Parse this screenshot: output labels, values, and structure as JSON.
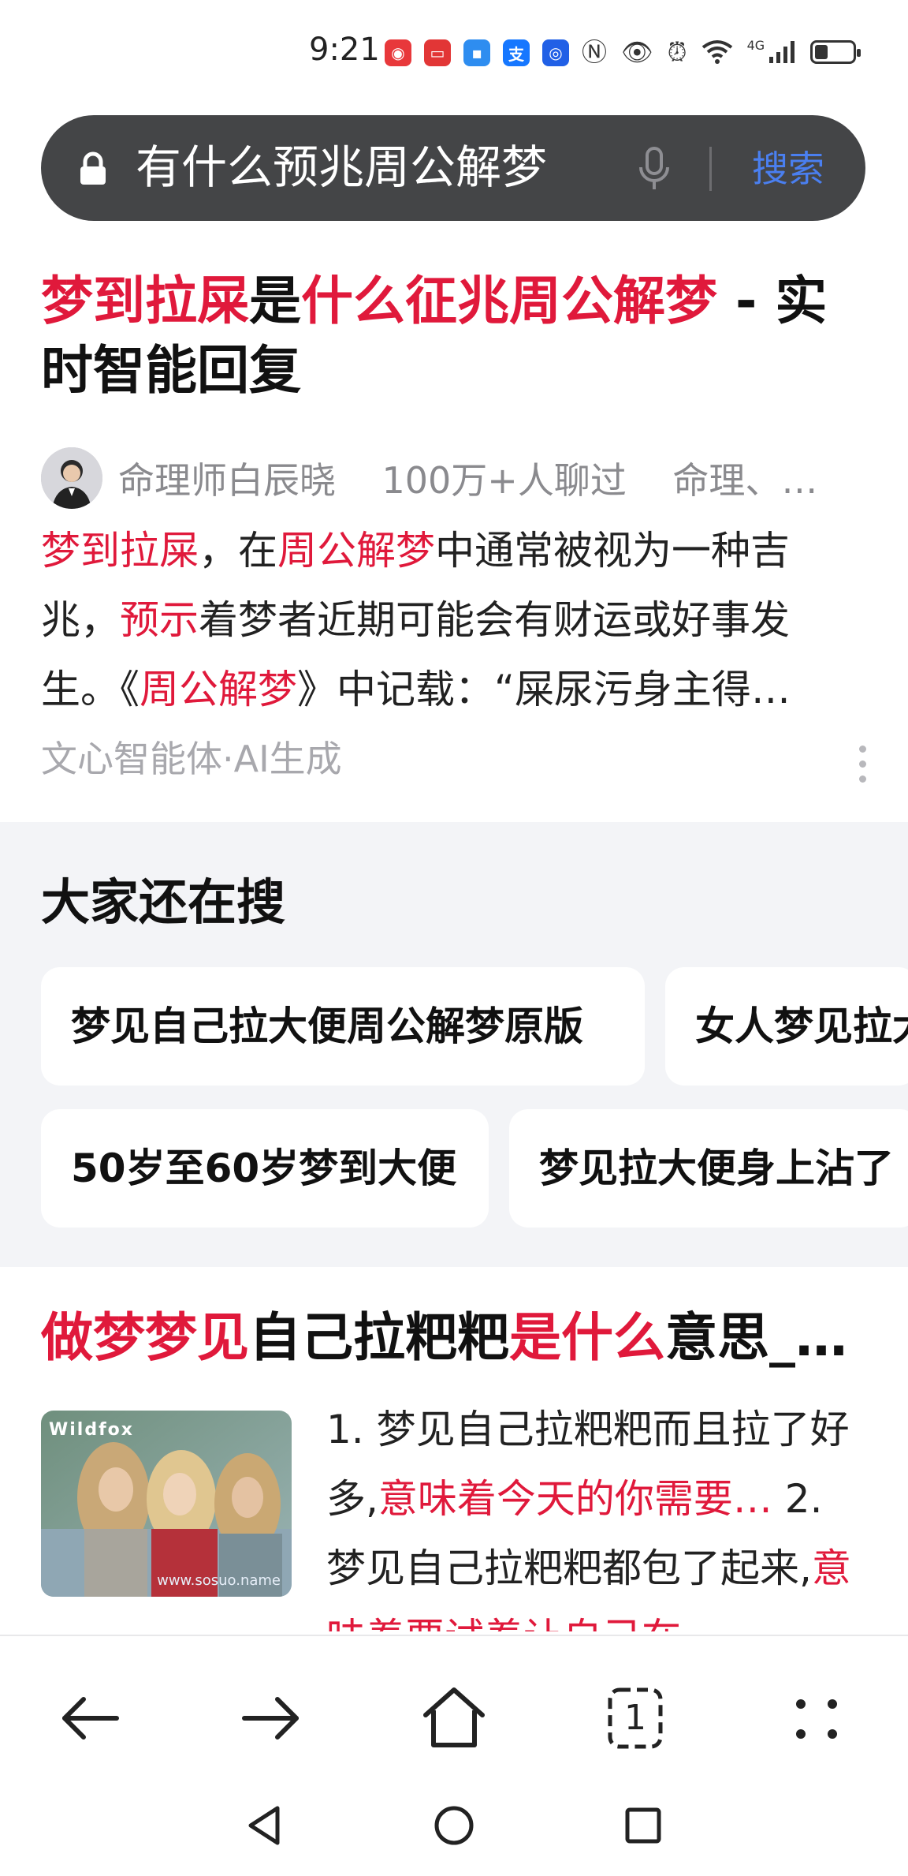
{
  "status_bar": {
    "time": "9:21",
    "app_icons": [
      {
        "name": "notification-app-icon-1",
        "color": "#e8383b",
        "glyph": "◉"
      },
      {
        "name": "notification-app-icon-2",
        "color": "#e23636",
        "glyph": "▭"
      },
      {
        "name": "notification-app-icon-3",
        "color": "#2e8df0",
        "glyph": "▪"
      },
      {
        "name": "alipay-icon",
        "color": "#1677ff",
        "glyph": "支"
      },
      {
        "name": "notification-app-icon-5",
        "color": "#2160e6",
        "glyph": "◎"
      }
    ],
    "network_type": "4G",
    "battery_level": 0.35
  },
  "search": {
    "query": "有什么预兆周公解梦",
    "button_label": "搜索"
  },
  "result1": {
    "title_parts": [
      {
        "text": "梦到拉屎",
        "highlight": true
      },
      {
        "text": "是",
        "highlight": false
      },
      {
        "text": "什么征兆周公解梦",
        "highlight": true
      },
      {
        "text": " - 实时智能回复",
        "highlight": false
      }
    ],
    "author": "命理师白辰晓",
    "author_meta": "100万+人聊过",
    "author_tags": "命理、…",
    "snippet_parts": [
      {
        "text": "梦到拉屎",
        "highlight": true
      },
      {
        "text": "，在",
        "highlight": false
      },
      {
        "text": "周公解梦",
        "highlight": true
      },
      {
        "text": "中通常被视为一种吉兆，",
        "highlight": false
      },
      {
        "text": "预示",
        "highlight": true
      },
      {
        "text": "着梦者近期可能会有财运或好事发生。《",
        "highlight": false
      },
      {
        "text": "周公解梦",
        "highlight": true
      },
      {
        "text": "》中记载：“屎尿污身主得…",
        "highlight": false
      }
    ],
    "source": "文心智能体·AI生成"
  },
  "related": {
    "title": "大家还在搜",
    "items": [
      "梦见自己拉大便周公解梦原版",
      "女人梦见拉大便",
      "50岁至60岁梦到大便",
      "梦见拉大便身上沾了"
    ]
  },
  "result2": {
    "title_parts": [
      {
        "text": "做梦梦见",
        "highlight": true
      },
      {
        "text": "自己拉粑粑",
        "highlight": false
      },
      {
        "text": "是什么",
        "highlight": true
      },
      {
        "text": "意思_…",
        "highlight": false
      }
    ],
    "thumbnail_brand": "Wildfox",
    "thumbnail_watermark": "www.sosuo.name",
    "snippet_parts": [
      {
        "text": "1. 梦见自己拉粑粑而且拉了好多,",
        "highlight": false
      },
      {
        "text": "意味着今天的你需要…",
        "highlight": true
      },
      {
        "text": " 2. 梦见自己拉粑粑都包了起来,",
        "highlight": false
      },
      {
        "text": "意味着要试着让自己在",
        "highlight": true
      }
    ]
  },
  "toolbar": {
    "tab_count": "1"
  }
}
